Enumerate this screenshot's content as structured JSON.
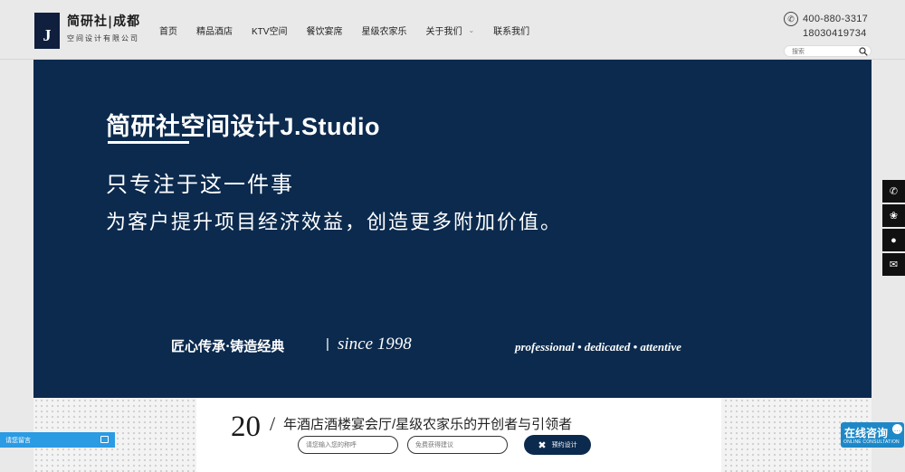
{
  "logo": {
    "mark": "J",
    "name": "简研社|成都",
    "sub": "空间设计有限公司"
  },
  "nav": {
    "items": [
      {
        "label": "首页"
      },
      {
        "label": "精品酒店"
      },
      {
        "label": "KTV空间"
      },
      {
        "label": "餐饮宴席"
      },
      {
        "label": "星级农家乐"
      },
      {
        "label": "关于我们",
        "has_dropdown": true
      },
      {
        "label": "联系我们"
      }
    ]
  },
  "contact": {
    "phone1": "400-880-3317",
    "phone2": "18030419734"
  },
  "search": {
    "placeholder": "搜索"
  },
  "banner": {
    "title": "简研社空间设计J.Studio",
    "line1": "只专注于这一件事",
    "line2": "为客户提升项目经济效益，创造更多附加价值。",
    "motto": "匠心传承·铸造经典",
    "separator": "|",
    "since": "since 1998",
    "tagline": "professional • dedicated • attentive",
    "background_color": "#0b2a4e"
  },
  "strip": {
    "years": "20",
    "slash": "/",
    "headline": "年酒店酒楼宴会厅/星级农家乐的开创者与引领者",
    "name_placeholder": "请您输入您的称呼",
    "advice_placeholder": "免费获得建议",
    "book_label": "预约设计"
  },
  "message_tab": {
    "label": "请您留言"
  },
  "side_toolbar": {
    "buttons": [
      {
        "icon": "phone-icon",
        "glyph": "✆"
      },
      {
        "icon": "paw-icon",
        "glyph": "❀"
      },
      {
        "icon": "qq-icon",
        "glyph": "●"
      },
      {
        "icon": "wechat-icon",
        "glyph": "✉"
      }
    ]
  },
  "consult": {
    "title": "在线咨询",
    "sub": "ONLINE CONSULTATION"
  },
  "colors": {
    "navy": "#0b2a4e",
    "accent_blue": "#2b9be3",
    "consult_blue": "#1e88c7"
  }
}
